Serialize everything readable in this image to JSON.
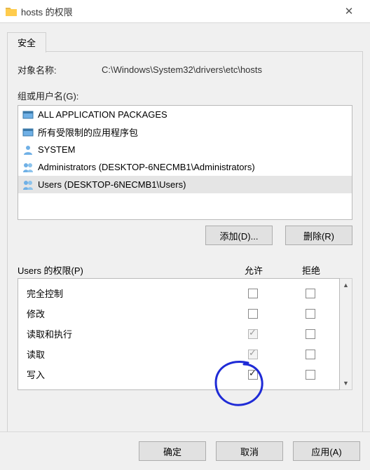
{
  "window": {
    "title": "hosts 的权限"
  },
  "tab": {
    "security_label": "安全"
  },
  "object": {
    "label": "对象名称:",
    "path": "C:\\Windows\\System32\\drivers\\etc\\hosts"
  },
  "groups": {
    "label": "组或用户名(G):",
    "items": [
      {
        "name": "ALL APPLICATION PACKAGES",
        "icon": "package"
      },
      {
        "name": "所有受限制的应用程序包",
        "icon": "package"
      },
      {
        "name": "SYSTEM",
        "icon": "user"
      },
      {
        "name": "Administrators (DESKTOP-6NECMB1\\Administrators)",
        "icon": "group"
      },
      {
        "name": "Users (DESKTOP-6NECMB1\\Users)",
        "icon": "group",
        "selected": true
      }
    ]
  },
  "buttons": {
    "add": "添加(D)...",
    "remove": "删除(R)",
    "ok": "确定",
    "cancel": "取消",
    "apply": "应用(A)"
  },
  "permissions": {
    "title": "Users 的权限(P)",
    "col_allow": "允许",
    "col_deny": "拒绝",
    "rows": [
      {
        "name": "完全控制",
        "allow": false,
        "deny": false,
        "inherited": false
      },
      {
        "name": "修改",
        "allow": false,
        "deny": false,
        "inherited": false
      },
      {
        "name": "读取和执行",
        "allow": true,
        "deny": false,
        "inherited": true
      },
      {
        "name": "读取",
        "allow": true,
        "deny": false,
        "inherited": true
      },
      {
        "name": "写入",
        "allow": true,
        "deny": false,
        "inherited": false,
        "highlight": true
      }
    ]
  },
  "annotation": {
    "color": "#1f2bd6"
  }
}
